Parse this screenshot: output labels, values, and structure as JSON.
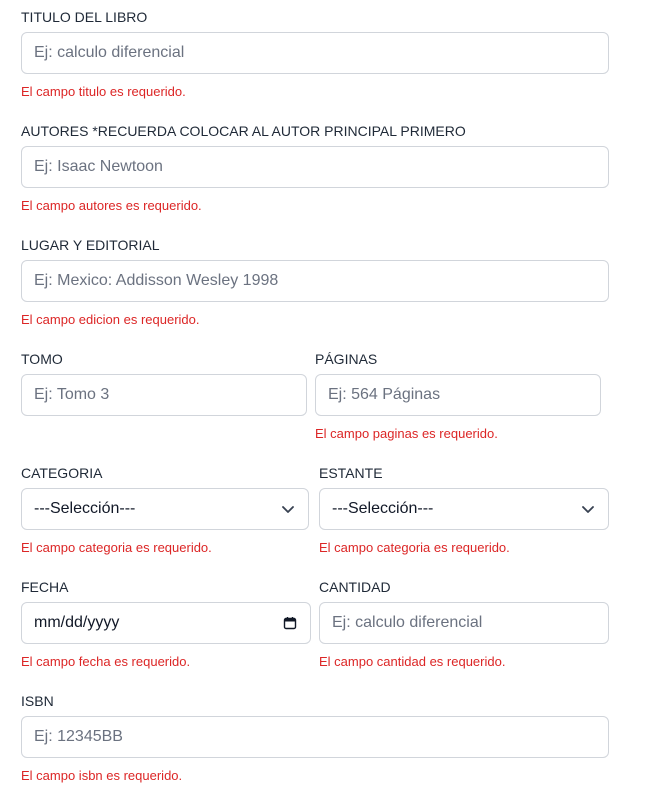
{
  "fields": {
    "titulo": {
      "label": "TITULO DEL LIBRO",
      "placeholder": "Ej: calculo diferencial",
      "error": "El campo titulo es requerido."
    },
    "autores": {
      "label": "AUTORES *RECUERDA COLOCAR AL AUTOR PRINCIPAL PRIMERO",
      "placeholder": "Ej: Isaac Newtoon",
      "error": "El campo autores es requerido."
    },
    "editorial": {
      "label": "LUGAR Y EDITORIAL",
      "placeholder": "Ej: Mexico: Addisson Wesley 1998",
      "error": "El campo edicion es requerido."
    },
    "tomo": {
      "label": "TOMO",
      "placeholder": "Ej: Tomo 3"
    },
    "paginas": {
      "label": "PÁGINAS",
      "placeholder": "Ej: 564 Páginas",
      "error": "El campo paginas es requerido."
    },
    "categoria": {
      "label": "CATEGORIA",
      "selected": "---Selección---",
      "error": "El campo categoria es requerido."
    },
    "estante": {
      "label": "ESTANTE",
      "selected": "---Selección---",
      "error": "El campo categoria es requerido."
    },
    "fecha": {
      "label": "FECHA",
      "value": "mm/dd/yyyy",
      "error": "El campo fecha es requerido."
    },
    "cantidad": {
      "label": "CANTIDAD",
      "placeholder": "Ej: calculo diferencial",
      "error": "El campo cantidad es requerido."
    },
    "isbn": {
      "label": "ISBN",
      "placeholder": "Ej: 12345BB",
      "error": "El campo isbn es requerido."
    }
  },
  "icons": {
    "select": "chevron-down-icon",
    "date": "calendar-icon"
  },
  "colors": {
    "error": "#dc2626",
    "border": "#d1d5db",
    "placeholder": "#6b7280",
    "label": "#1f2937"
  }
}
